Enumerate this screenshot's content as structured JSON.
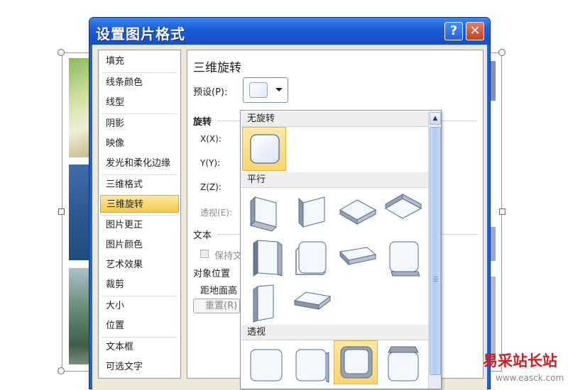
{
  "dialog": {
    "title": "设置图片格式",
    "help_glyph": "?",
    "close_glyph": "✕"
  },
  "nav": {
    "items": [
      {
        "label": "填充"
      },
      {
        "label": "线条颜色"
      },
      {
        "label": "线型"
      },
      {
        "label": "阴影"
      },
      {
        "label": "映像"
      },
      {
        "label": "发光和柔化边缘"
      },
      {
        "label": "三维格式"
      },
      {
        "label": "三维旋转",
        "selected": true
      },
      {
        "label": "图片更正"
      },
      {
        "label": "图片颜色"
      },
      {
        "label": "艺术效果"
      },
      {
        "label": "裁剪"
      },
      {
        "label": "大小"
      },
      {
        "label": "位置"
      },
      {
        "label": "文本框"
      },
      {
        "label": "可选文字"
      }
    ]
  },
  "panel": {
    "title": "三维旋转",
    "preset_label": "预设(P):",
    "rotation_section": "旋转",
    "x_label": "X(X):",
    "y_label": "Y(Y):",
    "z_label": "Z(Z):",
    "perspective_label": "透视(E):",
    "text_section": "文本",
    "keep_text_label": "保持文",
    "object_position_section": "对象位置",
    "distance_label": "距地面高",
    "reset_button": "重置(R)"
  },
  "gallery": {
    "sections": {
      "none": "无旋转",
      "parallel": "平行",
      "perspective": "透视"
    },
    "scroll_up": "▲",
    "selected_presets": [
      "无旋转 / 1",
      "透视 / 3"
    ]
  },
  "watermark": {
    "title": "易采站长站",
    "url": "www.easck.com"
  },
  "colors": {
    "titlebar": "#1c5bd8",
    "selection": "#f7c94a",
    "dialog_face": "#ece9d8"
  }
}
